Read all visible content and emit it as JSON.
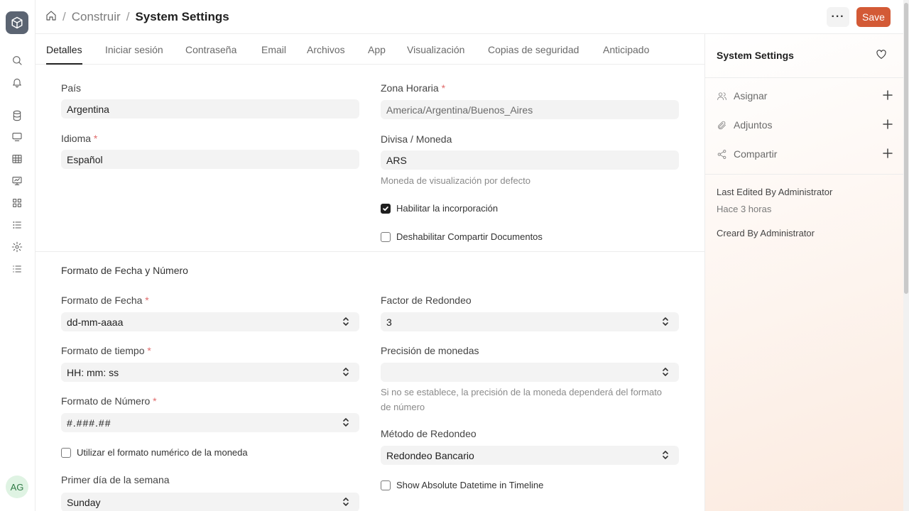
{
  "header": {
    "breadcrumb": [
      "Construir",
      "System Settings"
    ],
    "more_label": "···",
    "save_label": "Save"
  },
  "rail": {
    "avatar_initials": "AG",
    "icons": [
      "search-icon",
      "bell-icon",
      "database-icon",
      "monitor-icon",
      "table-icon",
      "presentation-icon",
      "grid-icon",
      "list-icon",
      "gear-icon",
      "list-alt-icon"
    ]
  },
  "tabs": [
    "Detalles",
    "Iniciar sesión",
    "Contraseña",
    "Email",
    "Archivos",
    "App",
    "Visualización",
    "Copias de seguridad",
    "Anticipado"
  ],
  "form": {
    "pais": {
      "label": "País",
      "value": "Argentina"
    },
    "zona": {
      "label": "Zona Horaria",
      "value": "America/Argentina/Buenos_Aires"
    },
    "idioma": {
      "label": "Idioma",
      "value": "Español"
    },
    "divisa": {
      "label": "Divisa / Moneda",
      "value": "ARS",
      "help": "Moneda de visualización por defecto"
    },
    "habilitar": {
      "label": "Habilitar la incorporación",
      "checked": true
    },
    "deshabilitar": {
      "label": "Deshabilitar Compartir Documentos",
      "checked": false
    },
    "section_title": "Formato de Fecha y Número",
    "fecha": {
      "label": "Formato de Fecha",
      "value": "dd-mm-aaaa"
    },
    "redondeo_factor": {
      "label": "Factor de Redondeo",
      "value": "3"
    },
    "tiempo": {
      "label": "Formato de tiempo",
      "value": "HH: mm: ss"
    },
    "precision": {
      "label": "Precisión de monedas",
      "value": "",
      "help": "Si no se establece, la precisión de la moneda dependerá del formato de número"
    },
    "numero": {
      "label": "Formato de Número",
      "value": "#.###.##"
    },
    "metodo": {
      "label": "Método de Redondeo",
      "value": "Redondeo Bancario"
    },
    "utilizar": {
      "label": "Utilizar el formato numérico de la moneda",
      "checked": false
    },
    "absolute": {
      "label": "Show Absolute Datetime in Timeline",
      "checked": false
    },
    "primer_dia": {
      "label": "Primer día de la semana",
      "value": "Sunday"
    }
  },
  "sidebar": {
    "title": "System Settings",
    "actions": [
      {
        "label": "Asignar",
        "icon": "users-icon"
      },
      {
        "label": "Adjuntos",
        "icon": "paperclip-icon"
      },
      {
        "label": "Compartir",
        "icon": "share-icon"
      }
    ],
    "last_edited": "Last Edited By Administrator",
    "last_edited_time": "Hace 3 horas",
    "created": "Creard By Administrator"
  }
}
